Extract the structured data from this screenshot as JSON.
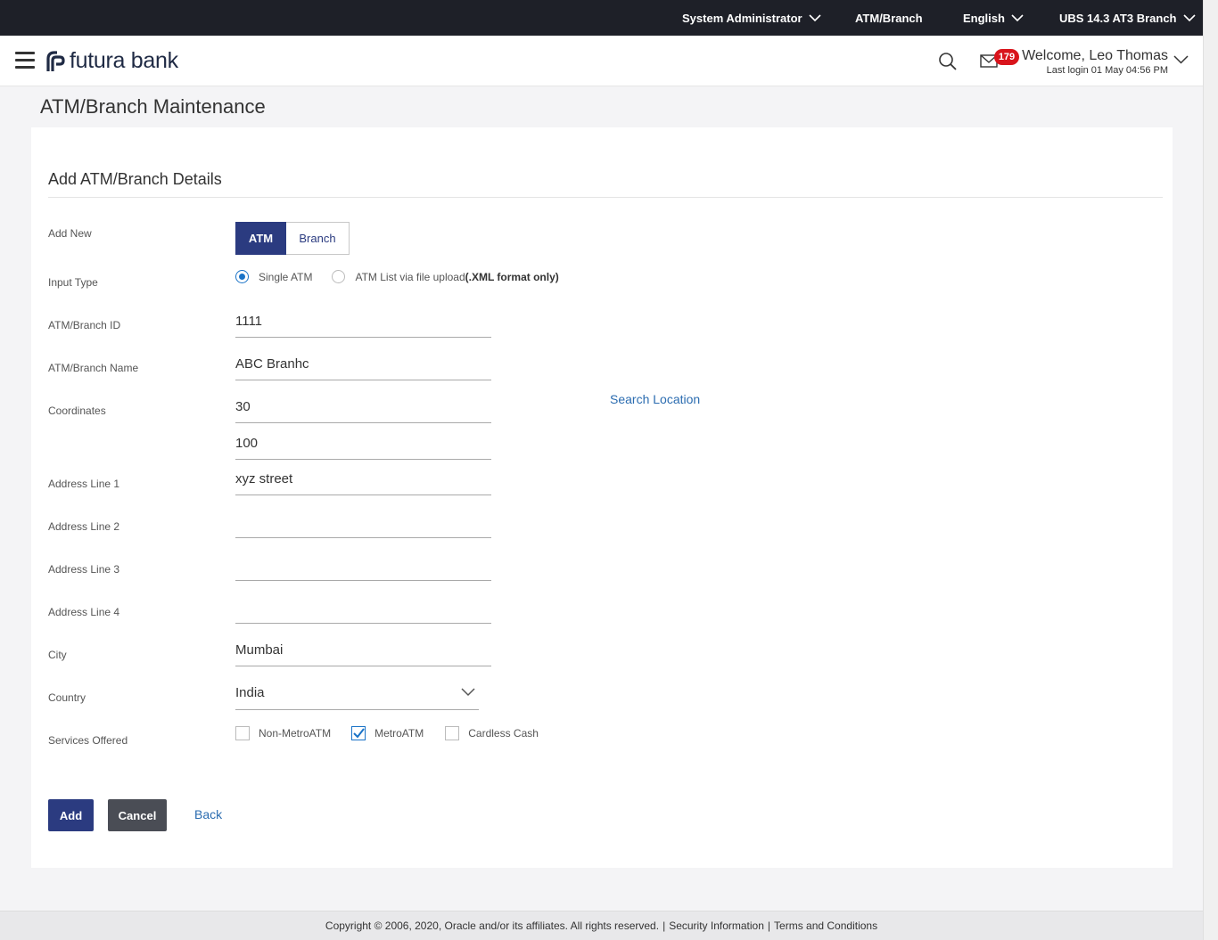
{
  "topbar": {
    "role": "System Administrator",
    "module": "ATM/Branch",
    "language": "English",
    "entity": "UBS 14.3 AT3 Branch"
  },
  "header": {
    "brand": "futura bank",
    "mail_count": "179",
    "welcome": "Welcome, Leo Thomas",
    "last_login": "Last login 01 May 04:56 PM"
  },
  "page": {
    "title": "ATM/Branch Maintenance",
    "section_title": "Add ATM/Branch Details"
  },
  "form": {
    "add_new_label": "Add New",
    "add_new_options": [
      "ATM",
      "Branch"
    ],
    "add_new_selected": "ATM",
    "input_type_label": "Input Type",
    "input_type_options": {
      "single": "Single ATM",
      "file": "ATM List via file upload",
      "file_note": "(.XML format only)"
    },
    "input_type_selected": "Single ATM",
    "id_label": "ATM/Branch ID",
    "id_value": "1111",
    "name_label": "ATM/Branch Name",
    "name_value": "ABC Branhc",
    "coordinates_label": "Coordinates",
    "latitude_value": "30",
    "longitude_value": "100",
    "search_location": "Search Location",
    "address1_label": "Address Line 1",
    "address1_value": "xyz street",
    "address2_label": "Address Line 2",
    "address2_value": "",
    "address3_label": "Address Line 3",
    "address3_value": "",
    "address4_label": "Address Line 4",
    "address4_value": "",
    "city_label": "City",
    "city_value": "Mumbai",
    "country_label": "Country",
    "country_value": "India",
    "services_label": "Services Offered",
    "services": [
      {
        "label": "Non-MetroATM",
        "checked": false
      },
      {
        "label": "MetroATM",
        "checked": true
      },
      {
        "label": "Cardless Cash",
        "checked": false
      }
    ]
  },
  "actions": {
    "add": "Add",
    "cancel": "Cancel",
    "back": "Back"
  },
  "footer": {
    "copyright": "Copyright © 2006, 2020, Oracle and/or its affiliates. All rights reserved.",
    "security": "Security Information",
    "terms": "Terms and Conditions"
  },
  "colors": {
    "primary": "#2b3b80",
    "link": "#2b6cb0",
    "topbar": "#1e2028",
    "badge": "#d9141c",
    "check": "#1a73c7"
  }
}
